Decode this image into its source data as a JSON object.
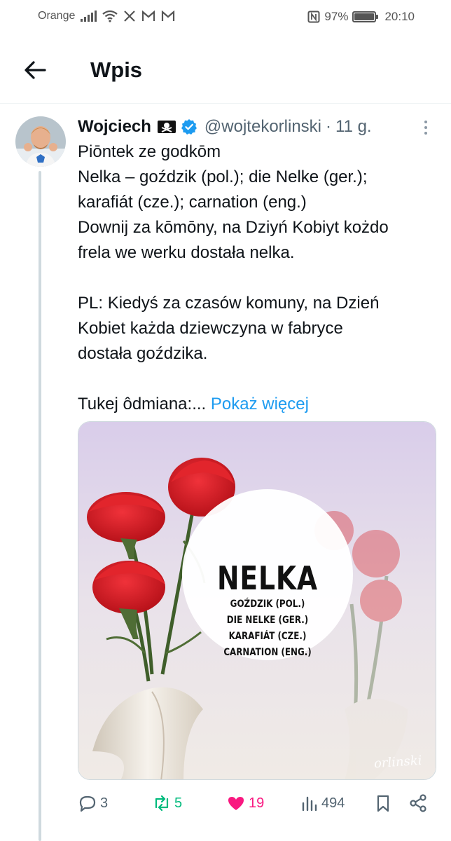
{
  "status_bar": {
    "carrier": "Orange",
    "battery_percent": "97%",
    "battery_level": 0.97,
    "time": "20:10",
    "icons": [
      "signal-icon",
      "wifi-icon",
      "x-icon",
      "gmail-icon",
      "gmail-icon",
      "nfc-icon",
      "battery-icon"
    ]
  },
  "header": {
    "title": "Wpis",
    "back_icon": "arrow-left-icon"
  },
  "post": {
    "author_name": "Wojciech",
    "flag_icon": "pirate-flag-icon",
    "verified_icon": "verified-badge-icon",
    "handle": "@wojtekorlinski",
    "separator": "·",
    "time": "11 g.",
    "lines": [
      "Piōntek ze godkōm",
      "Nelka – goździk (pol.); die Nelke (ger.);",
      "karafiát (cze.); carnation (eng.)",
      "Downij za kōmōny, na Dziyń Kobiyt kożdo",
      "frela  we werku dostała nelka."
    ],
    "lines_pl": [
      "PL: Kiedyś za czasów komuny, na Dzień",
      "Kobiet każda dziewczyna w fabryce",
      "dostała goździka."
    ],
    "last_line": "Tukej  ôdmiana:...",
    "show_more": "Pokaż więcej"
  },
  "media": {
    "headline": "NELKA",
    "sub_lines": [
      "GOŹDZIK (POL.)",
      "DIE NELKE (GER.)",
      "KARAFIÁT (CZE.)",
      "CARNATION (ENG.)"
    ],
    "signature": "orlinski",
    "colors": {
      "flower": "#d81a1f",
      "stem": "#3f5e2a",
      "vase": "#ece6dd",
      "bg_top": "#ddd3ee",
      "bg_bottom": "#efe9e6"
    }
  },
  "actions": {
    "replies": "3",
    "reposts": "5",
    "likes": "19",
    "views": "494",
    "colors": {
      "repost": "#00ba7c",
      "like": "#f91880",
      "muted": "#536471"
    }
  }
}
